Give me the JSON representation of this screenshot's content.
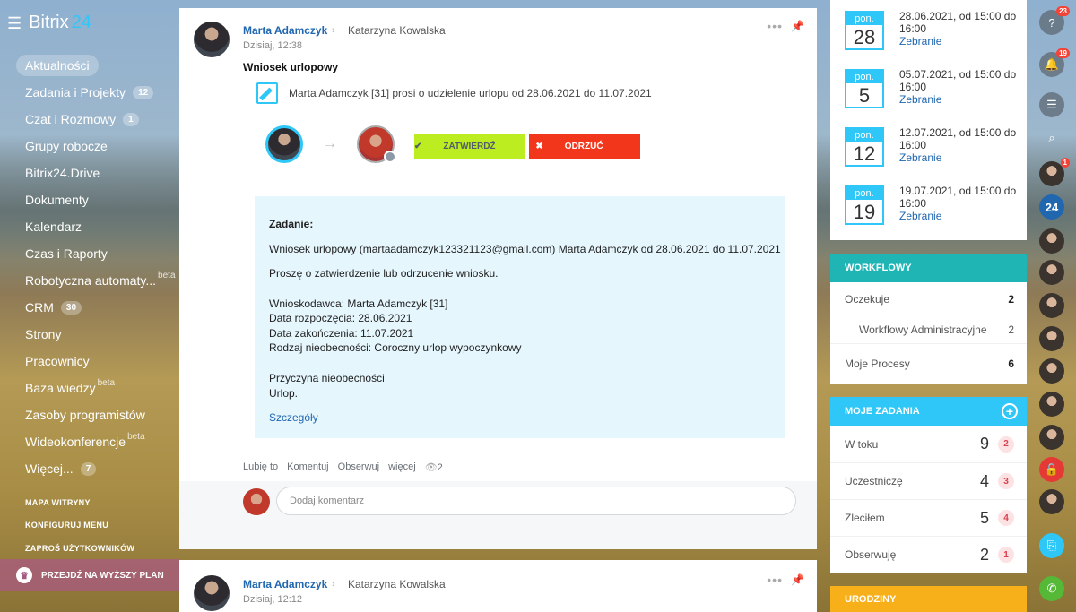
{
  "brand": {
    "name": "Bitrix",
    "suffix": "24"
  },
  "sidebar": {
    "items": [
      {
        "label": "Aktualności",
        "active": true
      },
      {
        "label": "Zadania i Projekty",
        "count": "12"
      },
      {
        "label": "Czat i Rozmowy",
        "count": "1"
      },
      {
        "label": "Grupy robocze"
      },
      {
        "label": "Bitrix24.Drive"
      },
      {
        "label": "Dokumenty"
      },
      {
        "label": "Kalendarz"
      },
      {
        "label": "Czas i Raporty"
      },
      {
        "label": "Robotyczna automaty...",
        "beta": "beta"
      },
      {
        "label": "CRM",
        "count": "30"
      },
      {
        "label": "Strony"
      },
      {
        "label": "Pracownicy"
      },
      {
        "label": "Baza wiedzy",
        "beta": "beta"
      },
      {
        "label": "Zasoby programistów"
      },
      {
        "label": "Wideokonferencje",
        "beta": "beta"
      },
      {
        "label": "Więcej...",
        "count": "7"
      }
    ],
    "system": [
      "MAPA WITRYNY",
      "KONFIGURUJ MENU",
      "ZAPROŚ UŻYTKOWNIKÓW"
    ],
    "upgrade": "PRZEJDŹ NA WYŻSZY PLAN"
  },
  "post": {
    "author": "Marta Adamczyk",
    "destination": "Katarzyna Kowalska",
    "date": "Dzisiaj, 12:38",
    "title": "Wniosek urlopowy",
    "request": "Marta Adamczyk [31] prosi o udzielenie urlopu od 28.06.2021 do 11.07.2021",
    "approve": "ZATWIERDŹ",
    "reject": "ODRZUĆ",
    "task": {
      "heading": "Zadanie:",
      "line1": "Wniosek urlopowy (martaadamczyk123321123@gmail.com) Marta Adamczyk od 28.06.2021 do 11.07.2021",
      "line2": "Proszę o zatwierdzenie lub odrzucenie wniosku.",
      "applicant": "Wnioskodawca:  Marta Adamczyk [31]",
      "start": "Data rozpoczęcia:  28.06.2021",
      "end": "Data zakończenia: 11.07.2021",
      "type": "Rodzaj nieobecności:   Coroczny urlop wypoczynkowy",
      "reason_label": "Przyczyna nieobecności",
      "reason": "Urlop.",
      "details": "Szczegóły"
    },
    "actions": {
      "like": "Lubię to",
      "comment": "Komentuj",
      "follow": "Obserwuj",
      "more": "więcej",
      "views": "2"
    },
    "comment_placeholder": "Dodaj komentarz"
  },
  "post2": {
    "author": "Marta Adamczyk",
    "destination": "Katarzyna Kowalska",
    "date": "Dzisiaj, 12:12"
  },
  "calendar": [
    {
      "day": "pon.",
      "num": "28",
      "text": "28.06.2021, od 15:00 do 16:00",
      "link": "Zebranie"
    },
    {
      "day": "pon.",
      "num": "5",
      "text": "05.07.2021, od 15:00 do 16:00",
      "link": "Zebranie"
    },
    {
      "day": "pon.",
      "num": "12",
      "text": "12.07.2021, od 15:00 do 16:00",
      "link": "Zebranie"
    },
    {
      "day": "pon.",
      "num": "19",
      "text": "19.07.2021, od 15:00 do 16:00",
      "link": "Zebranie"
    }
  ],
  "workflows": {
    "title": "WORKFLOWY",
    "rows": [
      {
        "label": "Oczekuje",
        "value": "2"
      },
      {
        "label": "Workflowy Administracyjne",
        "value": "2"
      },
      {
        "label": "Moje Procesy",
        "value": "6"
      }
    ]
  },
  "mytasks": {
    "title": "MOJE ZADANIA",
    "rows": [
      {
        "label": "W toku",
        "value": "9",
        "badge": "2"
      },
      {
        "label": "Uczestniczę",
        "value": "4",
        "badge": "3"
      },
      {
        "label": "Zleciłem",
        "value": "5",
        "badge": "4"
      },
      {
        "label": "Obserwuję",
        "value": "2",
        "badge": "1"
      }
    ]
  },
  "birthdays": "URODZINY",
  "rightbar": {
    "help_badge": "23",
    "notif_badge": "19",
    "user_badge": "1",
    "b24": "24"
  }
}
